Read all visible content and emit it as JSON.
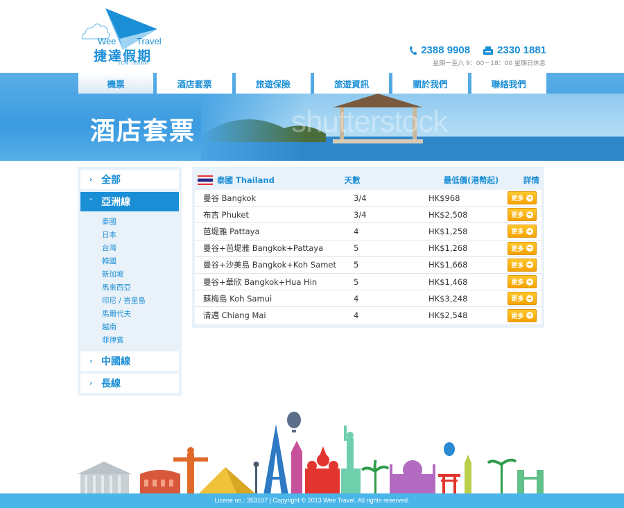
{
  "logo": {
    "en_left": "Wee",
    "en_right": "Travel",
    "cn": "捷達假期",
    "license": "LCN : 353107"
  },
  "contact": {
    "phone": "2388 9908",
    "fax": "2330 1881",
    "hours": "星期一至六 9：00－18：00  星期日休息"
  },
  "nav": {
    "tabs": [
      {
        "label": "機票",
        "active": true
      },
      {
        "label": "酒店套票",
        "active": false
      },
      {
        "label": "旅遊保險",
        "active": false
      },
      {
        "label": "旅遊資訊",
        "active": false
      },
      {
        "label": "關於我們",
        "active": false
      },
      {
        "label": "聯絡我們",
        "active": false
      }
    ]
  },
  "banner": {
    "title": "酒店套票",
    "watermark": "shutterstock"
  },
  "sidebar": {
    "categories": [
      {
        "label": "全部",
        "chevron": "›"
      },
      {
        "label": "亞洲線",
        "chevron": "ˇ"
      },
      {
        "label": "中國線",
        "chevron": "›"
      },
      {
        "label": "長線",
        "chevron": "›"
      }
    ],
    "subitems": [
      "泰國",
      "日本",
      "台灣",
      "韓國",
      "新加坡",
      "馬來西亞",
      "印尼 / 峇里島",
      "馬爾代夫",
      "越南",
      "菲律賓"
    ]
  },
  "table": {
    "country": "泰國 Thailand",
    "headers": {
      "days": "天數",
      "price": "最低價(港幣起)",
      "details": "詳情"
    },
    "more_label": "更多",
    "rows": [
      {
        "name": "曼谷 Bangkok",
        "days": "3/4",
        "price": "HK$968"
      },
      {
        "name": "布吉 Phuket",
        "days": "3/4",
        "price": "HK$2,508"
      },
      {
        "name": "芭堤雅 Pattaya",
        "days": "4",
        "price": "HK$1,258"
      },
      {
        "name": "曼谷+芭堤雅 Bangkok+Pattaya",
        "days": "5",
        "price": "HK$1,268"
      },
      {
        "name": "曼谷+沙美島 Bangkok+Koh Samet",
        "days": "5",
        "price": "HK$1,668"
      },
      {
        "name": "曼谷+華欣 Bangkok+Hua Hin",
        "days": "5",
        "price": "HK$1,468"
      },
      {
        "name": "蘇梅島 Koh Samui",
        "days": "4",
        "price": "HK$3,248"
      },
      {
        "name": "清邁 Chiang Mai",
        "days": "4",
        "price": "HK$2,548"
      }
    ]
  },
  "footer": {
    "text": "Licene no.: 353107 | Copyright © 2013 Wee Travel. All rights reserved."
  },
  "icons": {
    "phone": "phone-icon",
    "fax": "fax-icon",
    "flag": "thailand-flag-icon",
    "more_arrow": "arrow-right-circle-icon"
  },
  "colors": {
    "brand_blue": "#1b8fd6",
    "banner_blue": "#3b9be0",
    "button_orange": "#f5a300",
    "footer_blue": "#4ab5e8"
  }
}
